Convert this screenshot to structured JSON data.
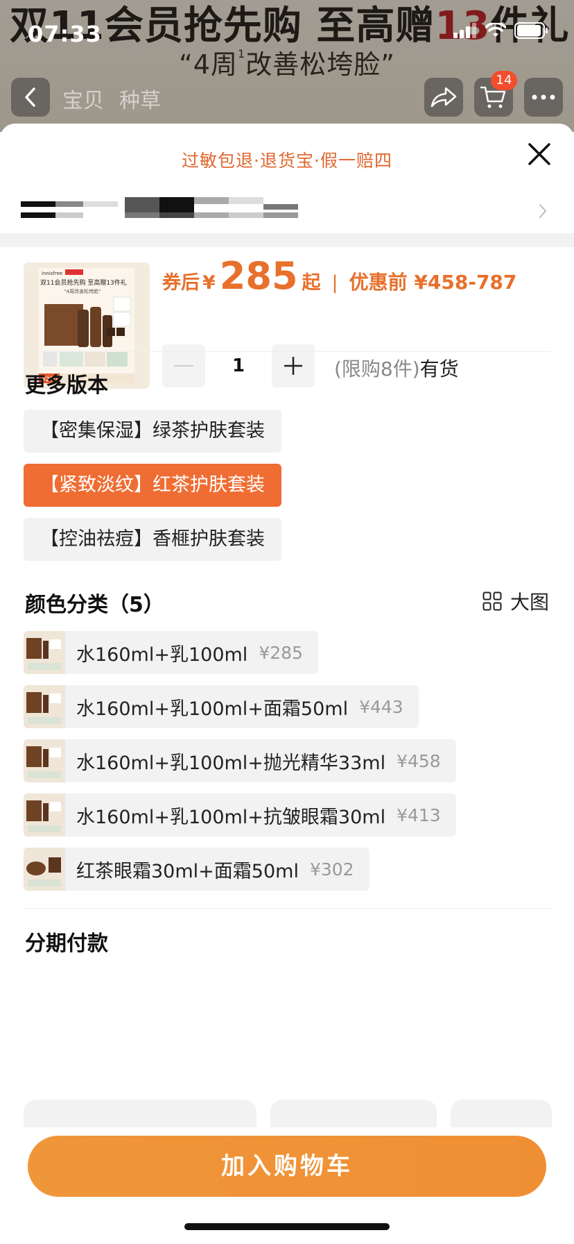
{
  "status_bar": {
    "time": "07:33"
  },
  "backdrop": {
    "promo_line1_a": "双11会员抢先购 至高赠",
    "promo_line1_num": "13",
    "promo_line1_b": "件礼",
    "promo_line2_a": "“4周",
    "promo_line2_sup": "1",
    "promo_line2_b": "改善松垮脸”"
  },
  "nav": {
    "tabs": [
      "宝贝",
      "种草"
    ],
    "cart_count": "14",
    "icons": [
      "back-icon",
      "share-icon",
      "cart-icon",
      "more-icon"
    ]
  },
  "sheet": {
    "guarantee": "过敏包退·退货宝·假一赔四",
    "product": {
      "price_label": "券后",
      "currency": "¥",
      "price": "285",
      "price_suffix": "起",
      "separator": "|",
      "original_label": "优惠前 ¥458-787",
      "thumb_text_brand": "innisfree",
      "thumb_text_title": "双11会员抢先购 至高赠13件礼",
      "thumb_text_sub": "“4周改善松垮脸”",
      "thumb_price": "¥270"
    },
    "quantity": {
      "value": "1",
      "limit_note": "(限购8件)",
      "stock": "有货"
    },
    "versions": {
      "title": "更多版本",
      "items": [
        {
          "label": "【密集保湿】绿茶护肤套装",
          "selected": false
        },
        {
          "label": "【紧致淡纹】红茶护肤套装",
          "selected": true
        },
        {
          "label": "【控油祛痘】香榧护肤套装",
          "selected": false
        }
      ]
    },
    "colors": {
      "title": "颜色分类（5）",
      "big_view_label": "大图",
      "items": [
        {
          "name": "水160ml+乳100ml",
          "price": "¥285"
        },
        {
          "name": "水160ml+乳100ml+面霜50ml",
          "price": "¥443"
        },
        {
          "name": "水160ml+乳100ml+抛光精华33ml",
          "price": "¥458"
        },
        {
          "name": "水160ml+乳100ml+抗皱眼霜30ml",
          "price": "¥413"
        },
        {
          "name": "红茶眼霜30ml+面霜50ml",
          "price": "¥302"
        }
      ]
    },
    "installment": {
      "title": "分期付款"
    },
    "cta_label": "加入购物车"
  },
  "colors": {
    "accent": "#ef6d33",
    "cta": "#f0963a",
    "price": "#e8702c",
    "guarantee": "#e0672e"
  }
}
